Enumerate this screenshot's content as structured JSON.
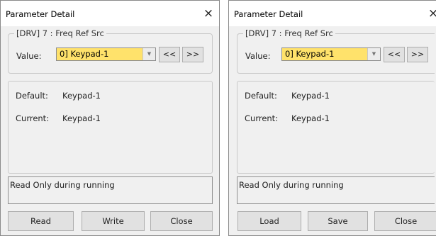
{
  "left_dialog": {
    "title": "Parameter Detail",
    "close_glyph": "×",
    "group_title": "[DRV] 7 : Freq Ref Src",
    "value_label": "Value:",
    "value_selected": "0] Keypad-1",
    "combo_arrow_glyph": "▼",
    "prev_label": "<<",
    "next_label": ">>",
    "default_label": "Default:",
    "default_value": "Keypad-1",
    "current_label": "Current:",
    "current_value": "Keypad-1",
    "description": "Read Only during running",
    "buttons": [
      "Read",
      "Write",
      "Close"
    ]
  },
  "right_dialog": {
    "title": "Parameter Detail",
    "close_glyph": "×",
    "group_title": "[DRV] 7 : Freq Ref Src",
    "value_label": "Value:",
    "value_selected": "0] Keypad-1",
    "combo_arrow_glyph": "▼",
    "prev_label": "<<",
    "next_label": ">>",
    "default_label": "Default:",
    "default_value": "Keypad-1",
    "current_label": "Current:",
    "current_value": "Keypad-1",
    "description": "Read Only during running",
    "buttons": [
      "Load",
      "Save",
      "Close"
    ]
  },
  "colors": {
    "dialog_bg": "#f0f0f0",
    "titlebar_bg": "#ffffff",
    "combo_highlight": "#ffe26b",
    "button_bg": "#e1e1e1",
    "border": "#adadad"
  }
}
